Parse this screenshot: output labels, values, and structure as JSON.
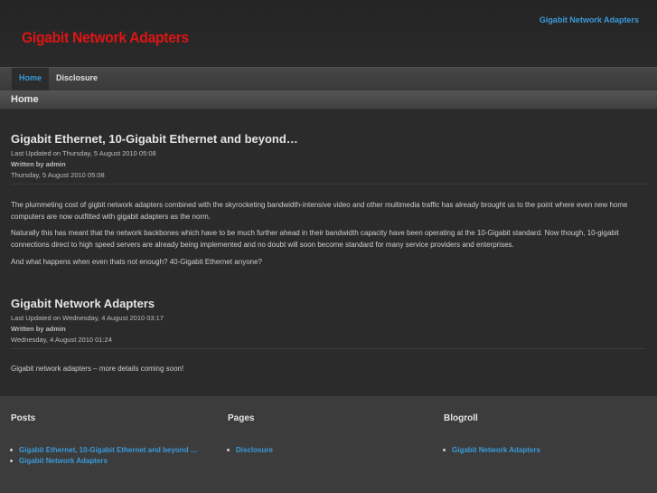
{
  "header": {
    "site_title": "Gigabit Network Adapters",
    "top_link": "Gigabit Network Adapters"
  },
  "nav": {
    "items": [
      {
        "label": "Home"
      },
      {
        "label": "Disclosure"
      }
    ]
  },
  "breadcrumb": "Home",
  "articles": [
    {
      "title": "Gigabit Ethernet, 10-Gigabit Ethernet and beyond…",
      "last_updated": "Last Updated on Thursday, 5 August 2010 05:08",
      "written_by": "Written by admin",
      "date": "Thursday, 5 August 2010 05:08",
      "paragraphs": [
        "The plummeting cost of gigbit network adapters combined with the skyrocketing bandwidth-intensive video and other multimedia traffic has already brought us to the point where even new home computers are now outfitted with gigabit adapters as the norm.",
        "Naturally this has meant that the network backbones which have to be much further ahead in their bandwidth capacity have been operating at the 10-Gigabit standard. Now though, 10-gigabit connections direct to high speed servers are already being implemented and no doubt will soon become standard for many service providers and enterprises.",
        "And what happens when even thats not enough? 40-Gigabit Ethernet anyone?"
      ]
    },
    {
      "title": "Gigabit Network Adapters",
      "last_updated": "Last Updated on Wednesday, 4 August 2010 03:17",
      "written_by": "Written by admin",
      "date": "Wednesday, 4 August 2010 01:24",
      "paragraphs": [
        "Gigabit network adapters – more details coming soon!"
      ]
    }
  ],
  "footer": {
    "posts": {
      "heading": "Posts",
      "items": [
        "Gigabit Ethernet, 10-Gigabit Ethernet and beyond …",
        "Gigabit Network Adapters"
      ]
    },
    "pages": {
      "heading": "Pages",
      "items": [
        "Disclosure"
      ]
    },
    "blogroll": {
      "heading": "Blogroll",
      "items": [
        "Gigabit Network Adapters"
      ]
    }
  },
  "colors": {
    "background": "#2b2b2b",
    "title_red": "#e01414",
    "link_blue": "#3a9ad9",
    "footer_bg": "#3c3c3c"
  }
}
